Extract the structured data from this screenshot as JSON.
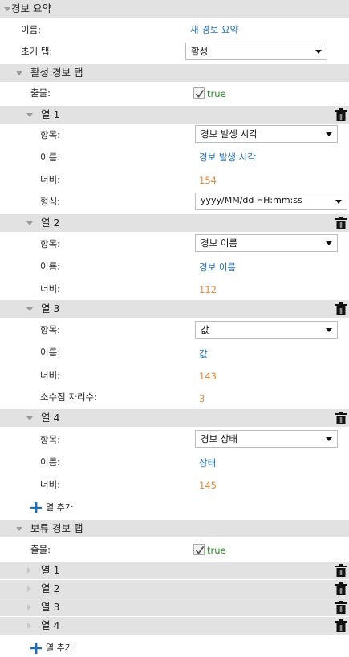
{
  "panel": {
    "title": "경보 요약",
    "name_label": "이름:",
    "name_value": "새 경보 요약",
    "initial_tab_label": "초기 탭:",
    "initial_tab_value": "활성"
  },
  "active_tab": {
    "title": "활성 경보 탭",
    "output_label": "출물:",
    "output_value": "true",
    "add_column_label": "열 추가",
    "columns": [
      {
        "title": "열 1",
        "item_label": "항목:",
        "item_value": "경보 발생 시각",
        "name_label": "이름:",
        "name_value": "경보 발생 시각",
        "width_label": "너비:",
        "width_value": "154",
        "format_label": "형식:",
        "format_value": "yyyy/MM/dd HH:mm:ss"
      },
      {
        "title": "열 2",
        "item_label": "항목:",
        "item_value": "경보 이름",
        "name_label": "이름:",
        "name_value": "경보 이름",
        "width_label": "너비:",
        "width_value": "112"
      },
      {
        "title": "열 3",
        "item_label": "항목:",
        "item_value": "값",
        "name_label": "이름:",
        "name_value": "값",
        "width_label": "너비:",
        "width_value": "143",
        "decimals_label": "소수점 자리수:",
        "decimals_value": "3"
      },
      {
        "title": "열 4",
        "item_label": "항목:",
        "item_value": "경보 상태",
        "name_label": "이름:",
        "name_value": "상태",
        "width_label": "너비:",
        "width_value": "145"
      }
    ]
  },
  "pending_tab": {
    "title": "보류 경보 탭",
    "output_label": "출물:",
    "output_value": "true",
    "add_column_label": "열 추가",
    "columns": [
      "열 1",
      "열 2",
      "열 3",
      "열 4"
    ]
  },
  "icons": {
    "trash": "trash-icon",
    "plus": "plus-icon",
    "check": "check-icon",
    "expand": "chevron-down-icon",
    "collapse": "chevron-right-icon"
  },
  "colors": {
    "header_bg": "#e2e2e2",
    "link": "#1f6fb0",
    "number": "#e08a3c",
    "accent": "#1f6fb0"
  }
}
